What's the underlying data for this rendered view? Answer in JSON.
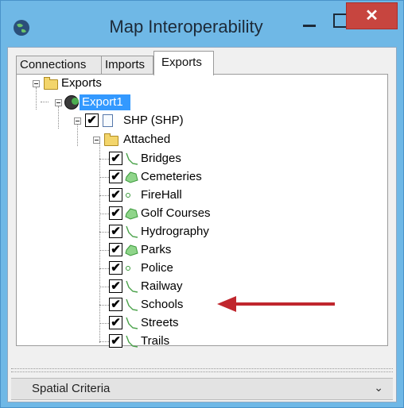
{
  "window": {
    "title": "Map Interoperability",
    "close_glyph": "✕"
  },
  "tabs": [
    {
      "label": "Connections"
    },
    {
      "label": "Imports"
    },
    {
      "label": "Exports"
    }
  ],
  "tree": {
    "root": "Exports",
    "export_node": "Export1",
    "format_node": "SHP (SHP)",
    "attached_node": "Attached",
    "layers": [
      {
        "label": "Bridges",
        "icon": "line-icon"
      },
      {
        "label": "Cemeteries",
        "icon": "polygon-icon"
      },
      {
        "label": "FireHall",
        "icon": "point-icon"
      },
      {
        "label": "Golf Courses",
        "icon": "polygon-icon"
      },
      {
        "label": "Hydrography",
        "icon": "line-icon"
      },
      {
        "label": "Parks",
        "icon": "polygon-icon"
      },
      {
        "label": "Police",
        "icon": "point-icon"
      },
      {
        "label": "Railway",
        "icon": "line-icon"
      },
      {
        "label": "Schools",
        "icon": "line-icon"
      },
      {
        "label": "Streets",
        "icon": "line-icon"
      },
      {
        "label": "Trails",
        "icon": "line-icon"
      }
    ],
    "checked": "✔"
  },
  "bottom": {
    "label": "Spatial Criteria",
    "chevron": "⌄"
  },
  "colors": {
    "selection": "#3399ff",
    "title_bar": "#6fb8e6",
    "close_button": "#c7453f",
    "arrow": "#c0262d"
  }
}
